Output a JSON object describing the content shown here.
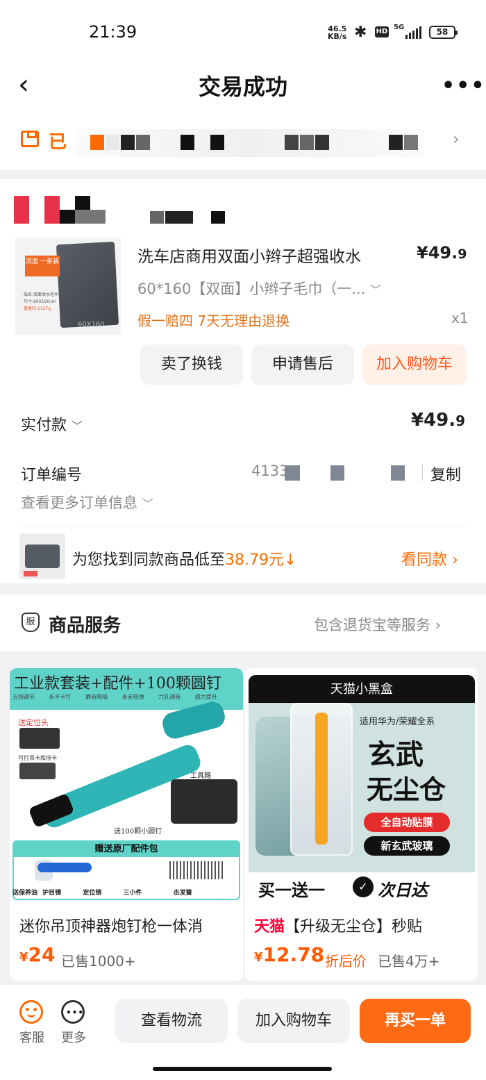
{
  "status_bar": {
    "time": "21:39",
    "net_speed": "46.5",
    "net_unit": "KB/s",
    "hd": "HD",
    "signal": "5G",
    "battery": "58"
  },
  "header": {
    "title": "交易成功"
  },
  "logistics": {
    "text": "已"
  },
  "order": {
    "product_name": "洗车店商用双面小辫子超强收水",
    "price_main": "¥49.",
    "price_dec": "9",
    "sku": "60*160【双面】小辫子毛巾（一...",
    "guarantee": "假一赔四  7天无理由退换",
    "quantity": "x1",
    "thumb_tag": "双面 一条装",
    "thumb_spec": [
      "品名:双面收水毛巾",
      "尺寸:60X160cm",
      "重量约:1327g"
    ],
    "thumb_size": "60X160",
    "actions": [
      "卖了换钱",
      "申请售后",
      "加入购物车"
    ],
    "paid_label": "实付款",
    "paid_main": "¥49.",
    "paid_dec": "9",
    "order_no_label": "订单编号",
    "order_no": "4133",
    "copy_label": "复制",
    "more_info": "查看更多订单信息",
    "similar_text": "为您找到同款商品低至",
    "similar_price": "38.79元",
    "similar_link": "看同款"
  },
  "service": {
    "title": "商品服务",
    "desc": "包含退货宝等服务",
    "badge": "服"
  },
  "recommendations": [
    {
      "banner": "工业款套装+配件+100颗圆钉",
      "name": "迷你吊顶神器炮钉枪一体消",
      "price_symbol": "¥",
      "price": "24",
      "sold": "已售1000+",
      "tags": [
        "五挡调节",
        "永不卡钉",
        "静音降噪",
        "永无哑弹",
        "六孔调音",
        "威力提升"
      ],
      "img_labels": [
        "送定位头",
        "可打吊卡和排卡",
        "工具箱",
        "送100颗小圆钉",
        "赠送原厂配件包",
        "送保养油",
        "护目镜",
        "定位销",
        "三小件",
        "击发簧"
      ]
    },
    {
      "banner": "天猫小黑盒",
      "brand": "天猫",
      "name": "【升级无尘仓】秒贴",
      "price_symbol": "¥",
      "price": "12.78",
      "discount_label": "折后价",
      "sold": "已售4万+",
      "img_labels": [
        "适用华为/荣耀全系",
        "玄武",
        "无尘仓",
        "全自动贴膜",
        "新玄武玻璃",
        "买一送一",
        "次日达"
      ]
    }
  ],
  "bottom_bar": {
    "service_label": "客服",
    "more_label": "更多",
    "logistics_btn": "查看物流",
    "cart_btn": "加入购物车",
    "rebuy_btn": "再买一单"
  }
}
